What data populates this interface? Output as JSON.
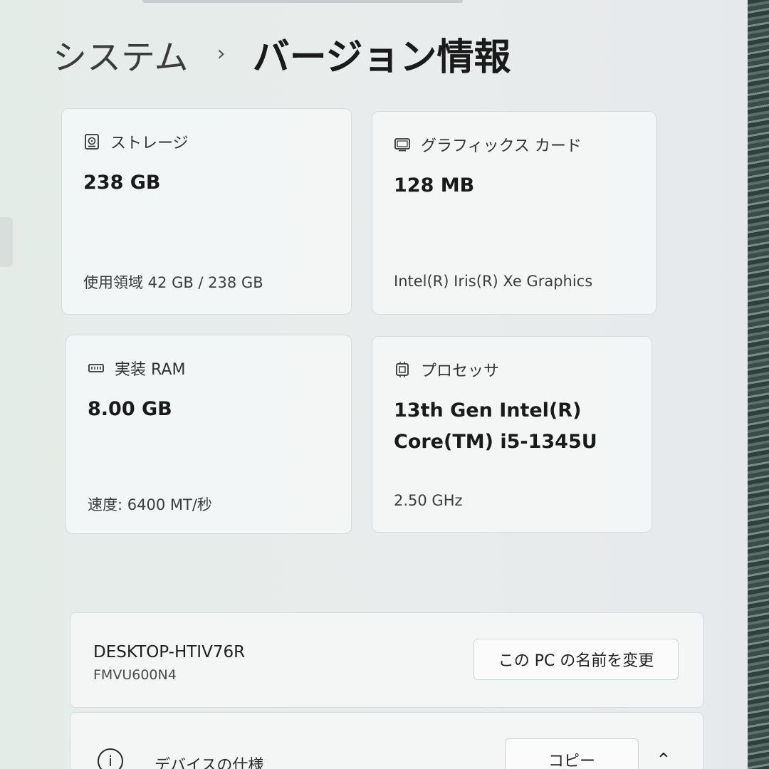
{
  "breadcrumb": {
    "parent": "システム",
    "separator": "›",
    "current": "バージョン情報"
  },
  "cards": {
    "storage": {
      "label": "ストレージ",
      "value": "238 GB",
      "sub": "使用領域 42 GB / 238 GB",
      "icon": "storage-icon"
    },
    "graphics": {
      "label": "グラフィックス カード",
      "value": "128 MB",
      "sub": "Intel(R) Iris(R) Xe Graphics",
      "icon": "display-icon"
    },
    "ram": {
      "label": "実装 RAM",
      "value": "8.00 GB",
      "sub": "速度: 6400 MT/秒",
      "icon": "ram-icon"
    },
    "processor": {
      "label": "プロセッサ",
      "value_line1": "13th Gen Intel(R)",
      "value_line2": "Core(TM) i5-1345U",
      "sub": "2.50 GHz",
      "icon": "cpu-icon"
    }
  },
  "device": {
    "name": "DESKTOP-HTIV76R",
    "model": "FMVU600N4",
    "rename_button": "この PC の名前を変更"
  },
  "specs": {
    "icon": "info-icon",
    "title": "デバイスの仕様",
    "copy_button": "コピー",
    "chevron": "chevron-up-icon"
  }
}
